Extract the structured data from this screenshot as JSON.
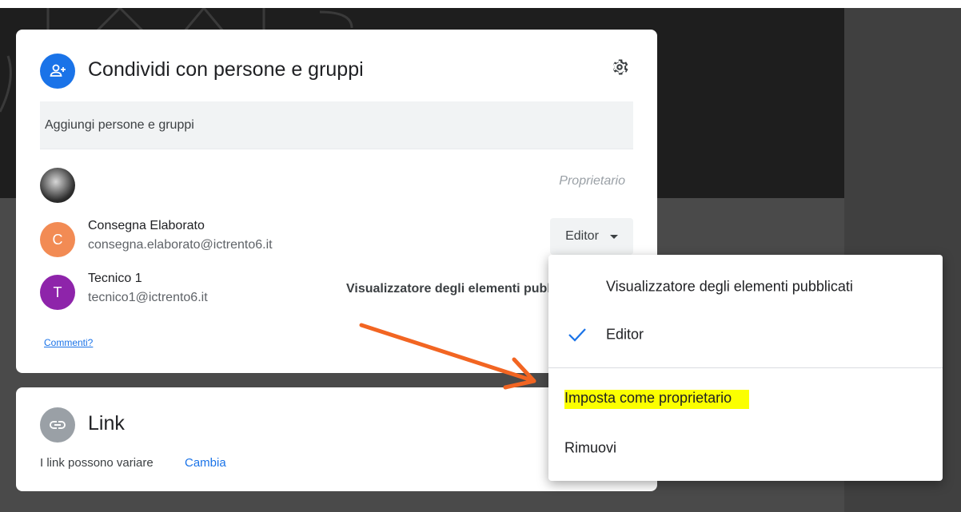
{
  "share": {
    "title": "Condividi con persone e gruppi",
    "add_placeholder": "Aggiungi persone e gruppi",
    "people": [
      {
        "name": "",
        "email": "",
        "role": "Proprietario",
        "avatar_letter": "",
        "avatar_color": "#2e2e2e"
      },
      {
        "name": "Consegna Elaborato",
        "email": "consegna.elaborato@ictrento6.it",
        "role": "Editor",
        "avatar_letter": "C",
        "avatar_color": "#f28b54"
      },
      {
        "name": "Tecnico 1",
        "email": "tecnico1@ictrento6.it",
        "role": "Visualizzatore degli elementi pubblicati",
        "avatar_letter": "T",
        "avatar_color": "#8e24aa"
      }
    ],
    "feedback_label": "Commenti?"
  },
  "link": {
    "title": "Link",
    "description": "I link possono variare",
    "change_label": "Cambia"
  },
  "role_menu": {
    "items": [
      {
        "label": "Visualizzatore degli elementi pubblicati",
        "checked": false
      },
      {
        "label": "Editor",
        "checked": true
      },
      {
        "label": "Imposta come proprietario",
        "highlighted": true
      },
      {
        "label": "Rimuovi"
      }
    ]
  },
  "colors": {
    "accent": "#1a73e8",
    "highlight": "#fbff00",
    "annotation_arrow": "#f26522"
  },
  "icons": {
    "share_header": "person-add-icon",
    "settings": "gear-icon",
    "link": "link-icon",
    "check": "check-icon",
    "dropdown": "caret-down-icon"
  }
}
